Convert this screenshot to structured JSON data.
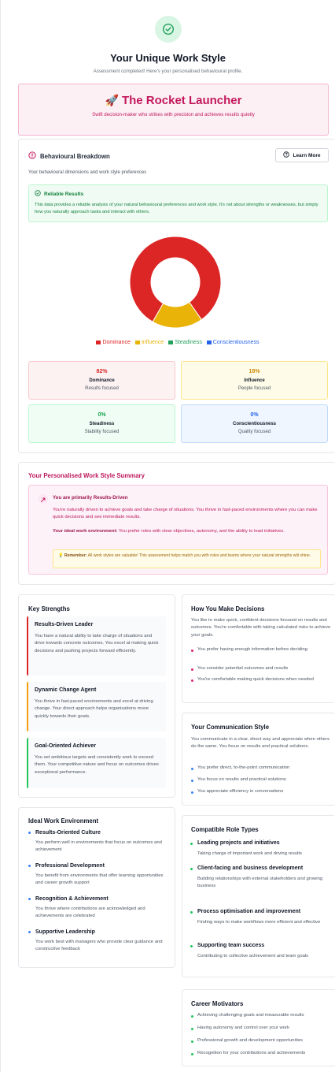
{
  "header": {
    "title": "Your Unique Work Style",
    "subtitle": "Assessment completed! Here's your personalised behavioural profile."
  },
  "persona": {
    "emoji": "🚀",
    "title": "The Rocket Launcher",
    "subtitle": "Swift decision-maker who strikes with precision and achieves results quietly"
  },
  "breakdown": {
    "title": "Behavioural Breakdown",
    "learn_more": "Learn More",
    "description": "Your behavioural dimensions and work style preferences",
    "reliable_title": "Reliable Results",
    "reliable_text": "This data provides a reliable analysis of your natural behavioural preferences and work style. It's not about strengths or weaknesses, but simply how you naturally approach tasks and interact with others.",
    "colors": {
      "dominance": "#dc2626",
      "influence": "#eab308",
      "steadiness": "#22a05a",
      "conscientiousness": "#2563eb"
    }
  },
  "chart_data": {
    "type": "pie",
    "categories": [
      "Dominance",
      "Influence",
      "Steadiness",
      "Conscientiousness"
    ],
    "values": [
      82,
      18,
      0,
      0
    ],
    "legend": "bottom"
  },
  "dimensions": [
    {
      "pct": "82%",
      "name": "Dominance",
      "desc": "Results focused"
    },
    {
      "pct": "18%",
      "name": "Influence",
      "desc": "People focused"
    },
    {
      "pct": "0%",
      "name": "Steadiness",
      "desc": "Stability focused"
    },
    {
      "pct": "0%",
      "name": "Conscientiousness",
      "desc": "Quality focused"
    }
  ],
  "summary": {
    "title": "Your Personalised Work Style Summary",
    "heading": "You are primarily Results-Driven",
    "para": "You're naturally driven to achieve goals and take charge of situations. You thrive in fast-paced environments where you can make quick decisions and see immediate results.",
    "ideal_label": "Your ideal work environment:",
    "ideal_text": " You prefer roles with clear objectives, autonomy, and the ability to lead initiatives.",
    "remember_label": "Remember:",
    "remember_text": " All work styles are valuable! This assessment helps match you with roles and teams where your natural strengths will shine."
  },
  "strengths": {
    "title": "Key Strengths",
    "items": [
      {
        "name": "Results-Driven Leader",
        "desc": "You have a natural ability to take charge of situations and drive towards concrete outcomes. You excel at making quick decisions and pushing projects forward efficiently."
      },
      {
        "name": "Dynamic Change Agent",
        "desc": "You thrive in fast-paced environments and excel at driving change. Your direct approach helps organisations move quickly towards their goals."
      },
      {
        "name": "Goal-Oriented Achiever",
        "desc": "You set ambitious targets and consistently work to exceed them. Your competitive nature and focus on outcomes drives exceptional performance."
      }
    ]
  },
  "decisions": {
    "title": "How You Make Decisions",
    "text": "You like to make quick, confident decisions focused on results and outcomes. You're comfortable with taking calculated risks to achieve your goals.",
    "bullets": [
      "You prefer having enough information before deciding",
      "You consider potential outcomes and results",
      "You're comfortable making quick decisions when needed"
    ]
  },
  "communication": {
    "title": "Your Communication Style",
    "text": "You communicate in a clear, direct way and appreciate when others do the same. You focus on results and practical solutions.",
    "bullets": [
      "You prefer direct, to-the-point communication",
      "You focus on results and practical solutions",
      "You appreciate efficiency in conversations"
    ]
  },
  "environment": {
    "title": "Ideal Work Environment",
    "items": [
      {
        "name": "Results-Oriented Culture",
        "desc": "You perform well in environments that focus on outcomes and achievement"
      },
      {
        "name": "Professional Development",
        "desc": "You benefit from environments that offer learning opportunities and career growth support"
      },
      {
        "name": "Recognition & Achievement",
        "desc": "You thrive where contributions are acknowledged and achievements are celebrated"
      },
      {
        "name": "Supportive Leadership",
        "desc": "You work best with managers who provide clear guidance and constructive feedback"
      }
    ]
  },
  "roles": {
    "title": "Compatible Role Types",
    "items": [
      {
        "name": "Leading projects and initiatives",
        "desc": "Taking charge of important work and driving results"
      },
      {
        "name": "Client-facing and business development",
        "desc": "Building relationships with external stakeholders and growing business"
      },
      {
        "name": "Process optimisation and improvement",
        "desc": "Finding ways to make workflows more efficient and effective"
      },
      {
        "name": "Supporting team success",
        "desc": "Contributing to collective achievement and team goals"
      }
    ]
  },
  "motivators": {
    "title": "Career Motivators",
    "bullets": [
      "Achieving challenging goals and measurable results",
      "Having autonomy and control over your work",
      "Professional growth and development opportunities",
      "Recognition for your contributions and achievements"
    ]
  }
}
